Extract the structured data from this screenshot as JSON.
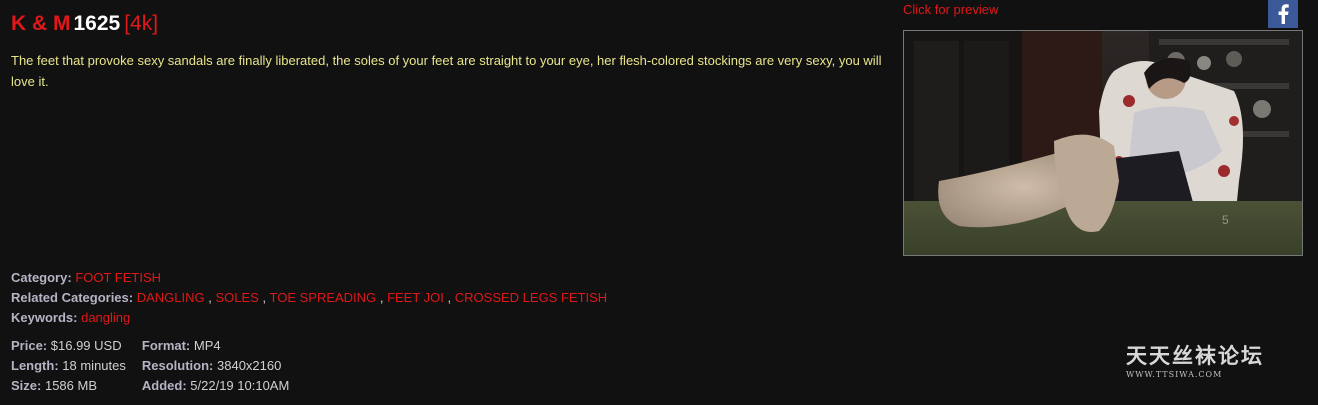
{
  "title": {
    "brand": "K & M",
    "number": "1625",
    "resolution_tag": "[4k]"
  },
  "description": "The feet that provoke sexy sandals are finally liberated, the soles of your feet are straight to your eye, her flesh-colored stockings are very sexy, you will love it.",
  "meta": {
    "category_label": "Category:",
    "category": "FOOT FETISH",
    "related_label": "Related Categories:",
    "related": [
      "DANGLING",
      "SOLES",
      "TOE SPREADING",
      "FEET JOI",
      "CROSSED LEGS FETISH"
    ],
    "separator": ",",
    "keywords_label": "Keywords:",
    "keywords": "dangling"
  },
  "specs": {
    "price_label": "Price:",
    "price": "$16.99 USD",
    "length_label": "Length:",
    "length": "18 minutes",
    "size_label": "Size:",
    "size": "1586 MB",
    "format_label": "Format:",
    "format": "MP4",
    "resolution_label": "Resolution:",
    "resolution": "3840x2160",
    "added_label": "Added:",
    "added": "5/22/19 10:10AM"
  },
  "preview": {
    "link_text": "Click for preview",
    "thumb_overlay": "5"
  },
  "social": {
    "icon": "facebook-icon"
  },
  "watermark": {
    "chinese": "天天丝袜论坛",
    "url": "WWW.TTSIWA.COM"
  },
  "colors": {
    "background": "#111112",
    "accent": "#e01818",
    "description": "#e9e58a",
    "label": "#b7b3c4",
    "facebook": "#3b5998"
  }
}
